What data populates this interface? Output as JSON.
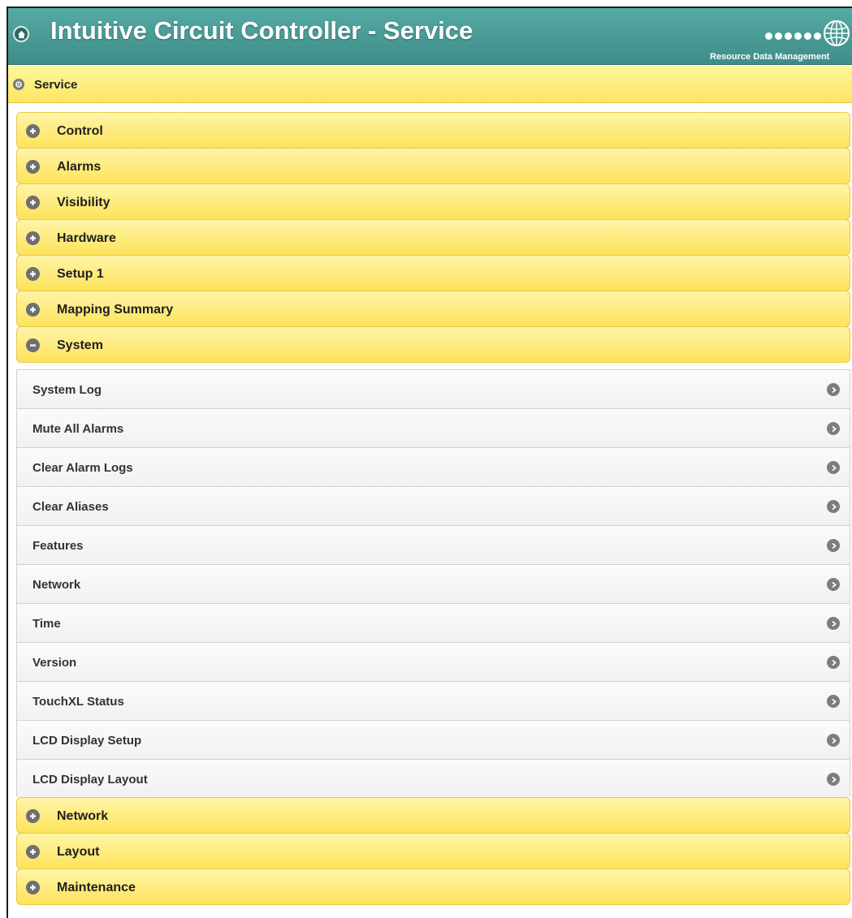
{
  "header": {
    "title": "Intuitive Circuit Controller - Service",
    "logo_text": "Resource Data Management",
    "home_icon": "home-icon",
    "colors": {
      "header_teal": "#4a9a95",
      "bar_yellow": "#fde661"
    }
  },
  "service_bar": {
    "label": "Service",
    "icon": "gear-icon"
  },
  "sections": [
    {
      "label": "Control",
      "state": "collapsed",
      "icon": "plus-icon"
    },
    {
      "label": "Alarms",
      "state": "collapsed",
      "icon": "plus-icon"
    },
    {
      "label": "Visibility",
      "state": "collapsed",
      "icon": "plus-icon"
    },
    {
      "label": "Hardware",
      "state": "collapsed",
      "icon": "plus-icon"
    },
    {
      "label": "Setup 1",
      "state": "collapsed",
      "icon": "plus-icon"
    },
    {
      "label": "Mapping Summary",
      "state": "collapsed",
      "icon": "plus-icon"
    },
    {
      "label": "System",
      "state": "expanded",
      "icon": "minus-icon"
    },
    {
      "label": "Network",
      "state": "collapsed",
      "icon": "plus-icon"
    },
    {
      "label": "Layout",
      "state": "collapsed",
      "icon": "plus-icon"
    },
    {
      "label": "Maintenance",
      "state": "collapsed",
      "icon": "plus-icon"
    }
  ],
  "system_items": [
    {
      "label": "System Log"
    },
    {
      "label": "Mute All Alarms"
    },
    {
      "label": "Clear Alarm Logs"
    },
    {
      "label": "Clear Aliases"
    },
    {
      "label": "Features"
    },
    {
      "label": "Network"
    },
    {
      "label": "Time"
    },
    {
      "label": "Version"
    },
    {
      "label": "TouchXL Status"
    },
    {
      "label": "LCD Display Setup"
    },
    {
      "label": "LCD Display Layout"
    }
  ]
}
